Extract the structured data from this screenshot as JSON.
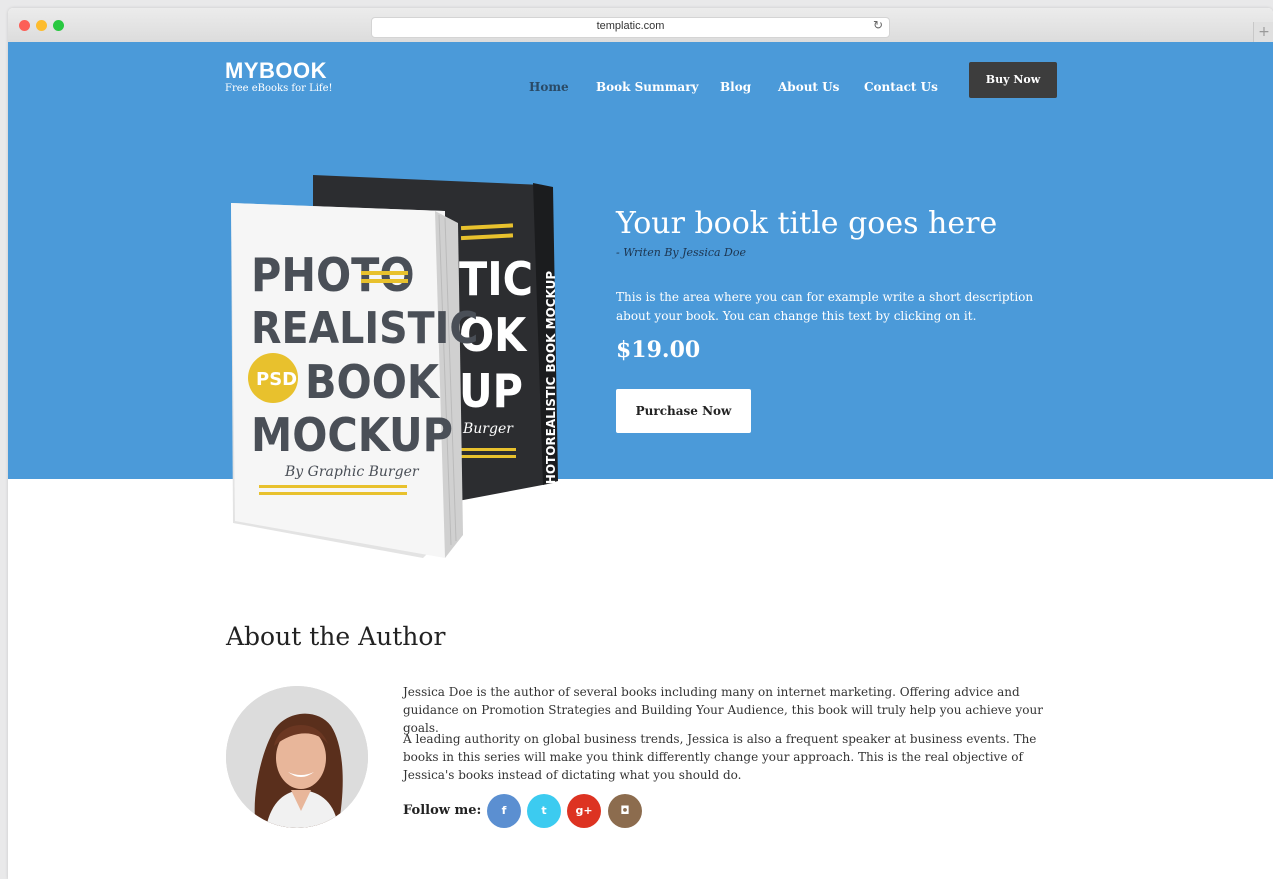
{
  "browser": {
    "url": "templatic.com",
    "reload_icon": "↻",
    "new_tab_icon": "+"
  },
  "header": {
    "logo_title": "MYBOOK",
    "logo_subtitle": "Free eBooks for Life!",
    "nav": [
      {
        "label": "Home",
        "active": true
      },
      {
        "label": "Book Summary",
        "active": false
      },
      {
        "label": "Blog",
        "active": false
      },
      {
        "label": "About Us",
        "active": false
      },
      {
        "label": "Contact Us",
        "active": false
      }
    ],
    "cta_label": "Buy Now"
  },
  "hero": {
    "title": "Your book title goes here",
    "author_line": "- Writen By Jessica Doe",
    "description": "This is the area where you can for example write a short description about your book. You can change this text by clicking on it.",
    "price": "$19.00",
    "purchase_label": "Purchase Now",
    "mockup": {
      "front_lines": [
        "PHOTO",
        "REALISTIC",
        "BOOK",
        "MOCKUP"
      ],
      "front_badge": "PSD",
      "front_byline": "By Graphic Burger",
      "back_lines": [
        "TIC",
        "OK",
        "UP"
      ],
      "back_byline": "Burger",
      "spine_text": "PHOTOREALISTIC BOOK MOCKUP"
    }
  },
  "about": {
    "heading": "About the Author",
    "paragraph_1": "Jessica Doe is the author of several books including many on internet marketing. Offering advice and guidance on Promotion Strategies and Building Your Audience, this book will truly help you achieve your goals.",
    "paragraph_2": "A leading authority on global business trends, Jessica is also a frequent speaker at business events. The books in this series will make you think differently change your approach. This is the real objective of Jessica's books instead of dictating what you should do.",
    "follow_label": "Follow me:",
    "social": [
      {
        "name": "facebook-icon",
        "glyph": "f",
        "color": "#5b8fd1"
      },
      {
        "name": "twitter-icon",
        "glyph": "t",
        "color": "#3ccbf0"
      },
      {
        "name": "google-plus-icon",
        "glyph": "g+",
        "color": "#dd3322"
      },
      {
        "name": "instagram-icon",
        "glyph": "◘",
        "color": "#8c6c4e"
      }
    ]
  },
  "colors": {
    "hero_bg": "#4b9ad9",
    "button_dark": "#3d3d3d",
    "active_nav": "#2a4a66",
    "book_yellow": "#e8c12d"
  }
}
